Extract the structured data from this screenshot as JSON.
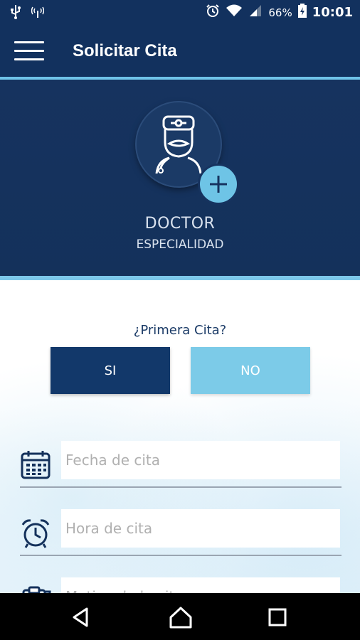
{
  "status_bar": {
    "left_icons": [
      "usb-icon",
      "signal-antenna-icon"
    ],
    "right_icons": [
      "alarm-icon",
      "wifi-icon",
      "cell-signal-icon",
      "battery-icon"
    ],
    "battery": "66%",
    "time": "10:01"
  },
  "app_bar": {
    "title": "Solicitar Cita",
    "menu_icon": "hamburger-menu-icon"
  },
  "doctor": {
    "name": "DOCTOR",
    "specialty": "ESPECIALIDAD",
    "avatar_icon": "doctor-icon",
    "add_icon": "plus-icon"
  },
  "form": {
    "first_appointment_question": "¿Primera Cita?",
    "yes_label": "SI",
    "no_label": "NO",
    "date_placeholder": "Fecha de cita",
    "time_placeholder": "Hora de cita",
    "reason_placeholder": "Motivo de la cita"
  },
  "colors": {
    "primary_dark": "#12315e",
    "accent_light": "#7ccbe8",
    "selected_button": "#12386a"
  },
  "nav_bar": {
    "icons": [
      "back-icon",
      "home-icon",
      "recents-icon"
    ]
  }
}
